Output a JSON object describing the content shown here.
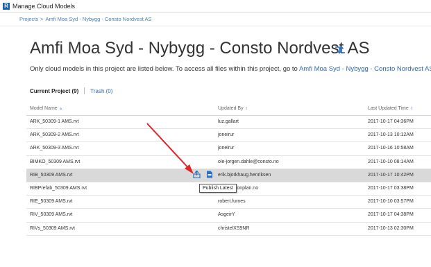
{
  "window": {
    "title": "Manage Cloud Models",
    "app_icon_letter": "R"
  },
  "breadcrumb": {
    "root": "Projects",
    "separator": ">",
    "current": "Amfi Moa Syd - Nybygg - Consto Nordvest AS"
  },
  "page": {
    "title": "Amfi Moa Syd - Nybygg - Consto Nordvest AS",
    "description_prefix": "Only cloud models in this project are listed below. To access all files within this project, go to",
    "description_link": "Amfi Moa Syd - Nybygg - Consto Nordvest AS."
  },
  "tabs": {
    "current": "Current Project (9)",
    "trash": "Trash (0)"
  },
  "table": {
    "columns": [
      "Model Name",
      "Updated By",
      "Last Updated Time"
    ],
    "rows": [
      {
        "name": "ARK_50309-1 AMS.rvt",
        "by": "luz.gallart",
        "time": "2017-10-17 04:36PM"
      },
      {
        "name": "ARK_50309-2 AMS.rvt",
        "by": "joneirur",
        "time": "2017-10-13 10:12AM"
      },
      {
        "name": "ARK_50309-3 AMS.rvt",
        "by": "joneirur",
        "time": "2017-10-16 10:58AM"
      },
      {
        "name": "BIMKO_50309 AMS.rvt",
        "by": "ole-jorgen.dahle@consto.no",
        "time": "2017-10-10 08:14AM"
      },
      {
        "name": "RIB_50309 AMS.rvt",
        "by": "erik.bjorkhaug.henriksen",
        "time": "2017-10-17 10:42PM"
      },
      {
        "name": "RIBPrefab_50309 AMS.rvt",
        "by": "wenn@conplan.no",
        "time": "2017-10-17 03:38PM"
      },
      {
        "name": "RIE_50309 AMS.rvt",
        "by": "robert.furnes",
        "time": "2017-10-10 03:57PM"
      },
      {
        "name": "RIV_50309 AMS.rvt",
        "by": "AsgeirY",
        "time": "2017-10-17 04:38PM"
      },
      {
        "name": "RIVs_50309 AMS.rvt",
        "by": "christelXS9NR",
        "time": "2017-10-13 02:30PM"
      }
    ]
  },
  "tooltip": {
    "text": "Publish Latest"
  },
  "icons": {
    "sync": "sync-icon",
    "publish": "publish-icon",
    "document": "document-icon",
    "annotation_arrow": "red-arrow"
  },
  "colors": {
    "link": "#2d6bb5",
    "highlight_row": "#d9d9d9",
    "arrow": "#e0242a",
    "icon_blue": "#2a72c4"
  }
}
